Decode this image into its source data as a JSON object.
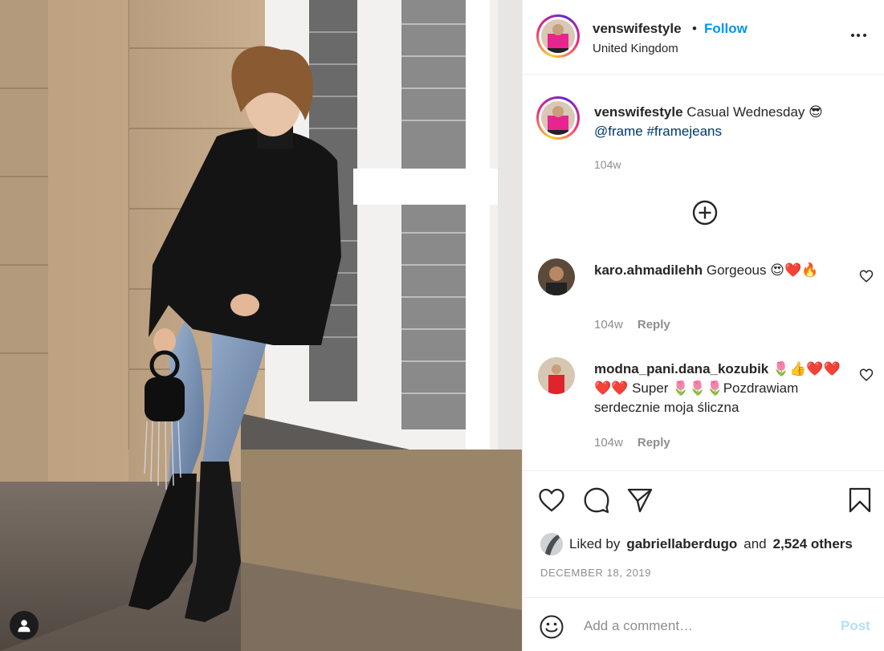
{
  "post": {
    "username": "venswifestyle",
    "dot": "•",
    "follow_label": "Follow",
    "location": "United Kingdom",
    "more_icon": "more-horizontal-icon"
  },
  "caption": {
    "username": "venswifestyle",
    "text": "Casual Wednesday",
    "emoji": "😎",
    "mention": "@frame",
    "hashtag": "#framejeans",
    "time": "104w"
  },
  "comments": [
    {
      "username": "karo.ahmadilehh",
      "text": "Gorgeous",
      "emoji": "😍❤️🔥",
      "time": "104w",
      "reply_label": "Reply"
    },
    {
      "username": "modna_pani.dana_kozubik",
      "emoji_lead": "🌷👍❤️❤️❤️❤️",
      "text_mid": "Super",
      "emoji_mid": "🌷🌷🌷",
      "text_end": "Pozdrawiam serdecznie moja śliczna",
      "time": "104w",
      "reply_label": "Reply"
    }
  ],
  "likes": {
    "prefix": "Liked by",
    "user": "gabriellaberdugo",
    "and": "and",
    "others": "2,524 others"
  },
  "date": "DECEMBER 18, 2019",
  "comment_box": {
    "placeholder": "Add a comment…",
    "post_label": "Post"
  },
  "colors": {
    "follow": "#0095f6",
    "secondary_text": "#8e8e8e",
    "post_disabled": "#b2dffc",
    "hashtag": "#00376b"
  }
}
